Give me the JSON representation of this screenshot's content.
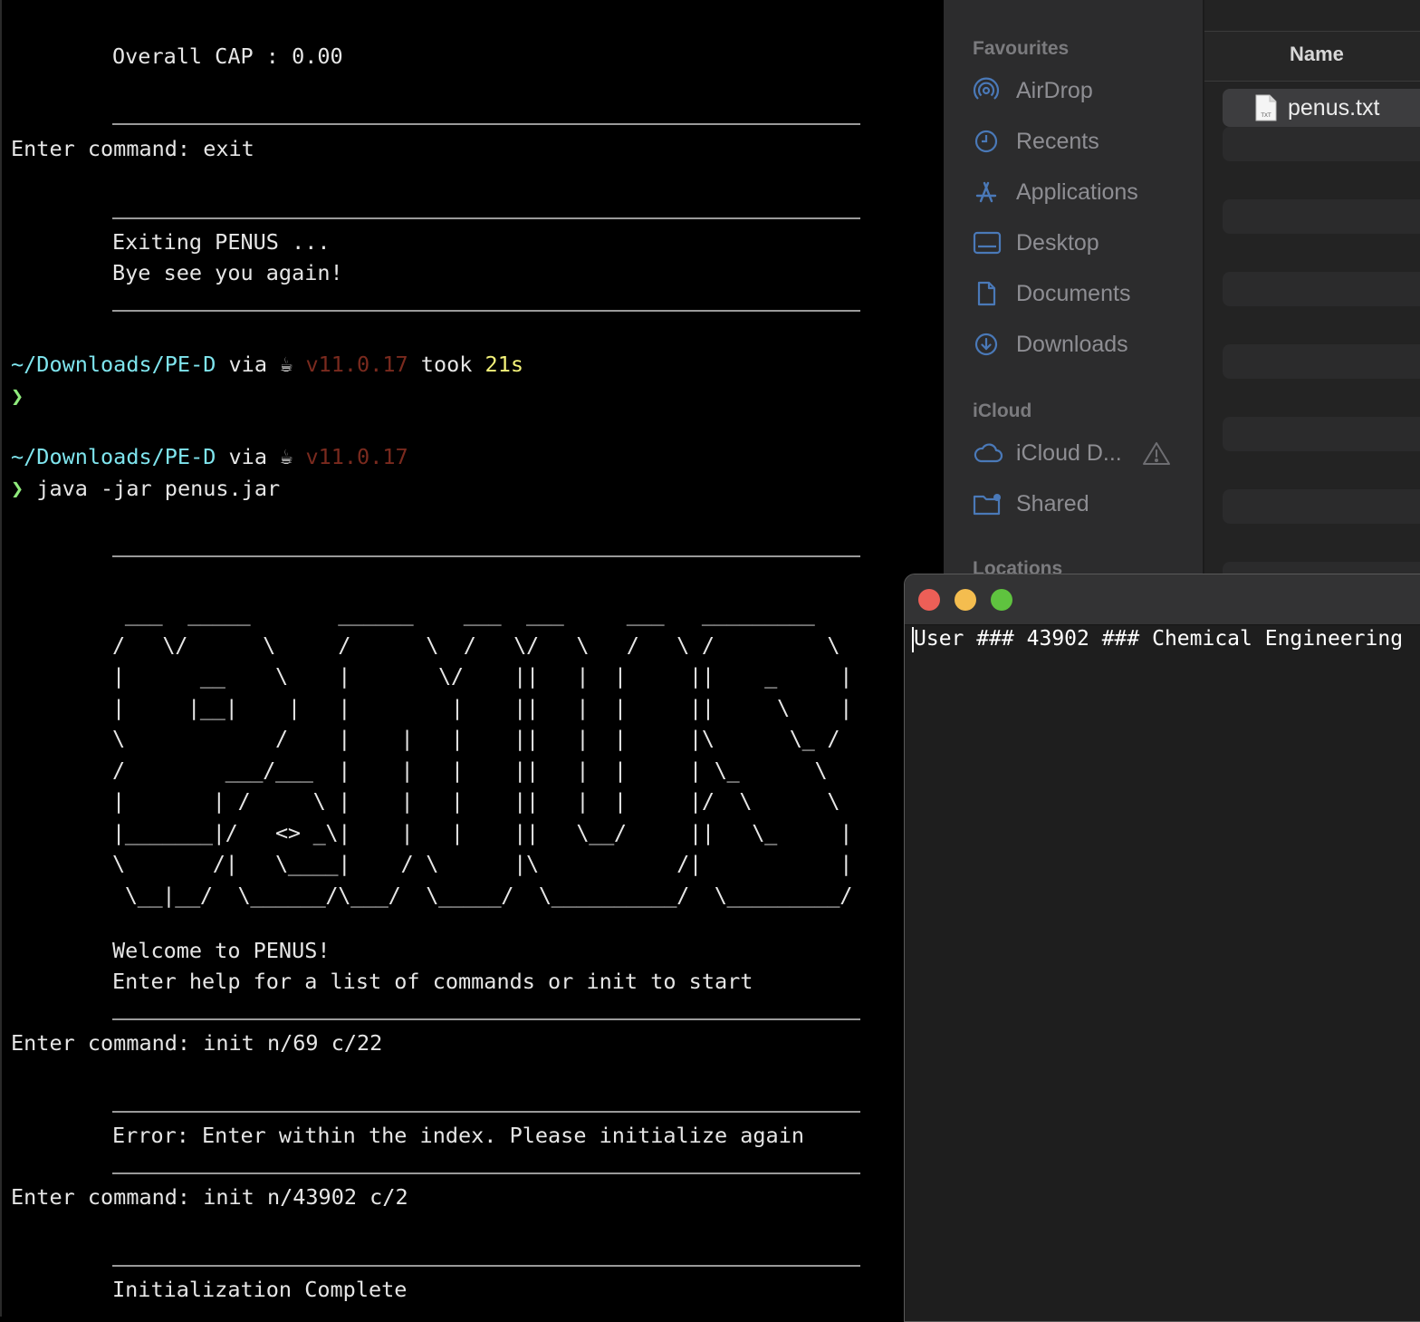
{
  "terminal": {
    "overall_cap": "Overall CAP : 0.00",
    "cmd_exit": "Enter command: exit",
    "exiting": "Exiting PENUS ...",
    "bye": "Bye see you again!",
    "prompt1": {
      "path": "~/Downloads/PE-D",
      "via": "via",
      "java_icon": "☕",
      "version": "v11.0.17",
      "took": "took",
      "time": "21s"
    },
    "prompt_symbol": "❯",
    "prompt2": {
      "path": "~/Downloads/PE-D",
      "via": "via",
      "java_icon": "☕",
      "version": "v11.0.17"
    },
    "command_java": "java -jar penus.jar",
    "ascii_art": " ___  _____       ______    ___  ___     ___   _________\n/   \\/      \\     /      \\  /   \\/   \\   /   \\ /         \\\n|      __    \\    |       \\/    ||   |  |     ||    _     |\n|     |__|    |   |        |    ||   |  |     ||     \\    |\n\\            /    |    |   |    ||   |  |     |\\      \\_ /\n/        ___/___  |    |   |    ||   |  |     | \\_      \\\n|       | /     \\ |    |   |    ||   |  |     |/  \\      \\\n|_______|/   <> _\\|    |   |    ||   \\__/     ||   \\_     |\n\\       /|   \\____|    / \\      |\\           /|           |\n \\__|__/  \\______/\\___/  \\_____/  \\__________/  \\_________/",
    "welcome": "Welcome to PENUS!",
    "help_hint": "Enter help for a list of commands or init to start",
    "cmd_init1": "Enter command: init n/69 c/22",
    "error": "Error: Enter within the index. Please initialize again",
    "cmd_init2": "Enter command: init n/43902 c/2",
    "init_complete": "Initialization Complete"
  },
  "finder": {
    "favourites_heading": "Favourites",
    "favourites": [
      {
        "label": "AirDrop",
        "icon": "airdrop-icon"
      },
      {
        "label": "Recents",
        "icon": "clock-icon"
      },
      {
        "label": "Applications",
        "icon": "applications-icon"
      },
      {
        "label": "Desktop",
        "icon": "desktop-icon"
      },
      {
        "label": "Documents",
        "icon": "document-icon"
      },
      {
        "label": "Downloads",
        "icon": "download-icon"
      }
    ],
    "icloud_heading": "iCloud",
    "icloud": [
      {
        "label": "iCloud D...",
        "icon": "cloud-icon"
      },
      {
        "label": "Shared",
        "icon": "shared-folder-icon"
      }
    ],
    "locations_heading": "Locations",
    "column_name": "Name",
    "file": {
      "name": "penus.txt",
      "badge": "TXT"
    }
  },
  "textedit": {
    "content": "User ### 43902 ### Chemical Engineering"
  },
  "colors": {
    "prompt_path": "#7fe5ee",
    "prompt_symbol": "#8fea7c",
    "java_version": "#7a2a1e",
    "duration": "#f4f27a",
    "traffic_close": "#ed5f57",
    "traffic_minimize": "#f4bd4f",
    "traffic_zoom": "#5fc33f"
  }
}
